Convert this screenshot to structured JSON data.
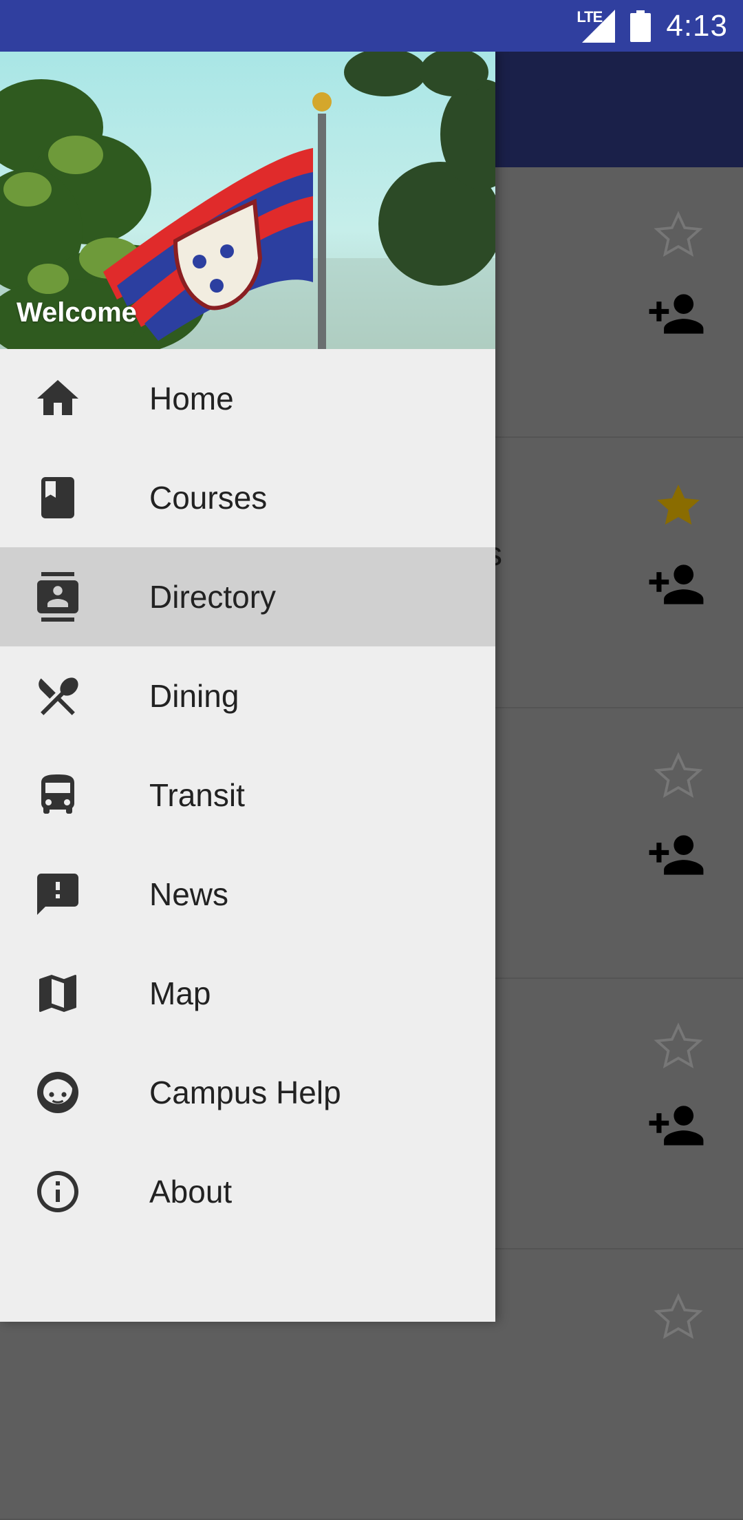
{
  "status_bar": {
    "network": "LTE",
    "time": "4:13"
  },
  "drawer": {
    "header": {
      "welcome": "Welcome"
    },
    "items": [
      {
        "label": "Home",
        "icon": "home-icon",
        "selected": false
      },
      {
        "label": "Courses",
        "icon": "book-icon",
        "selected": false
      },
      {
        "label": "Directory",
        "icon": "contacts-icon",
        "selected": true
      },
      {
        "label": "Dining",
        "icon": "dining-icon",
        "selected": false
      },
      {
        "label": "Transit",
        "icon": "bus-icon",
        "selected": false
      },
      {
        "label": "News",
        "icon": "feedback-icon",
        "selected": false
      },
      {
        "label": "Map",
        "icon": "map-icon",
        "selected": false
      },
      {
        "label": "Campus Help",
        "icon": "face-icon",
        "selected": false
      },
      {
        "label": "About",
        "icon": "info-icon",
        "selected": false
      }
    ]
  },
  "background_list": {
    "cards": [
      {
        "starred": false
      },
      {
        "starred": true,
        "fragment": "s"
      },
      {
        "starred": false
      },
      {
        "starred": false
      }
    ]
  },
  "colors": {
    "status_bar": "#303f9f",
    "app_bar": "#1a237e",
    "drawer_bg": "#eeeeee",
    "selected_item": "#d0d0d0",
    "star_filled": "#8a6c00"
  }
}
